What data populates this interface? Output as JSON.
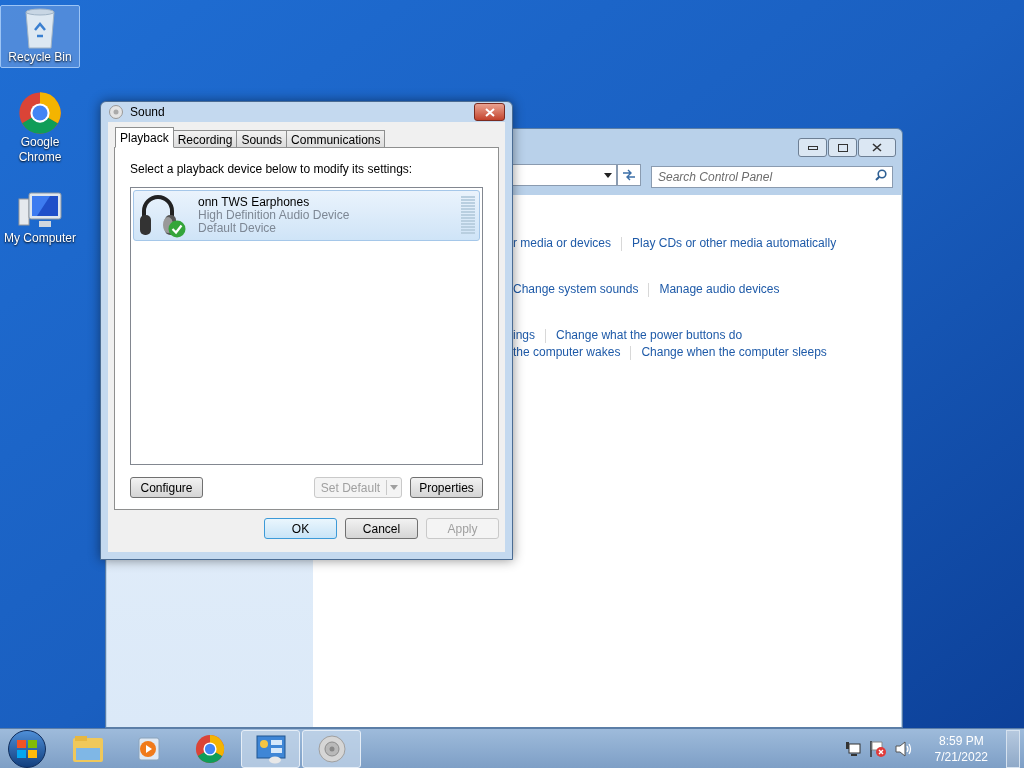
{
  "desktop_icons": [
    {
      "kind": "recycle",
      "label": "Recycle Bin",
      "selected": true
    },
    {
      "kind": "chrome",
      "label": "Google Chrome",
      "selected": false
    },
    {
      "kind": "computer",
      "label": "My Computer",
      "selected": false
    }
  ],
  "control_panel": {
    "search": {
      "placeholder": "Search Control Panel"
    },
    "link_rows": [
      [
        "r media or devices",
        "Play CDs or other media automatically"
      ],
      [
        "Change system sounds",
        "Manage audio devices"
      ],
      [
        "ings",
        "Change what the power buttons do"
      ],
      [
        "the computer wakes",
        "Change when the computer sleeps"
      ]
    ]
  },
  "sound_dialog": {
    "title": "Sound",
    "tabs": [
      {
        "label": "Playback",
        "selected": true
      },
      {
        "label": "Recording",
        "selected": false
      },
      {
        "label": "Sounds",
        "selected": false
      },
      {
        "label": "Communications",
        "selected": false
      }
    ],
    "instruction": "Select a playback device below to modify its settings:",
    "devices": [
      {
        "name": "onn TWS Earphones",
        "driver": "High Definition Audio Device",
        "status": "Default Device",
        "selected": true,
        "is_default": true
      }
    ],
    "configure": {
      "label": "Configure",
      "disabled": false
    },
    "set_default": {
      "label": "Set Default",
      "disabled": true
    },
    "properties": {
      "label": "Properties",
      "disabled": false
    },
    "buttons": [
      {
        "label": "OK",
        "disabled": false,
        "focused": true
      },
      {
        "label": "Cancel",
        "disabled": false,
        "focused": false
      },
      {
        "label": "Apply",
        "disabled": true,
        "focused": false
      }
    ]
  },
  "taskbar": {
    "items": [
      {
        "kind": "explorer",
        "active": false
      },
      {
        "kind": "media",
        "active": false
      },
      {
        "kind": "chrome",
        "active": false
      },
      {
        "kind": "control-panel",
        "active": true
      },
      {
        "kind": "speaker",
        "active": true
      }
    ],
    "clock": {
      "time": "8:59 PM",
      "date": "7/21/2022"
    }
  }
}
